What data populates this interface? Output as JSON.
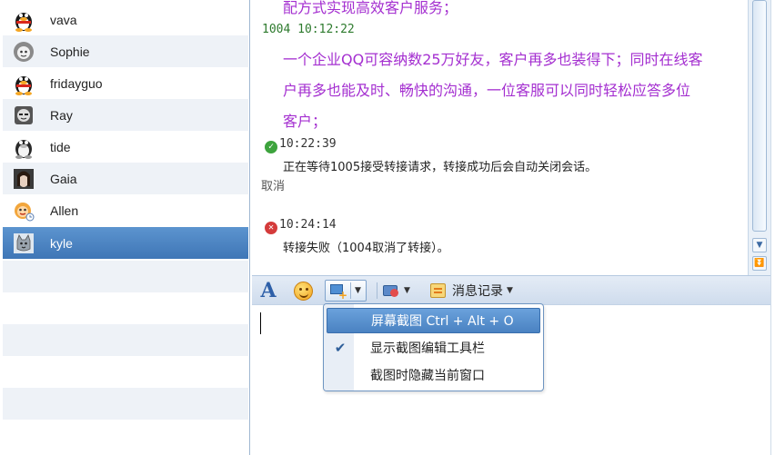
{
  "contacts": [
    {
      "name": "vava",
      "avatar": "penguin-icon"
    },
    {
      "name": "Sophie",
      "avatar": "avatar-girl-icon"
    },
    {
      "name": "fridayguo",
      "avatar": "penguin-icon"
    },
    {
      "name": "Ray",
      "avatar": "avatar-face-icon"
    },
    {
      "name": "tide",
      "avatar": "penguin-icon"
    },
    {
      "name": "Gaia",
      "avatar": "avatar-photo-icon"
    },
    {
      "name": "Allen",
      "avatar": "avatar-cartoon-icon"
    },
    {
      "name": "kyle",
      "avatar": "avatar-cat-icon",
      "selected": true
    }
  ],
  "chat": {
    "line_top": "配方式实现高效客户服务；",
    "msg1_meta": "1004  10:12:22",
    "msg1_line1": "一个企业QQ可容纳数25万好友，客户再多也装得下；同时在线客",
    "msg1_line2": "户再多也能及时、畅快的沟通，一位客服可以同时轻松应答多位",
    "msg1_line3": "客户；",
    "sys1_time": "10:22:39",
    "sys1_text": "正在等待1005接受转接请求，转接成功后会自动关闭会话。",
    "cancel": "取消",
    "sys2_time": "10:24:14",
    "sys2_text": "转接失败（1004取消了转接）。"
  },
  "toolbar": {
    "font_label": "A",
    "history_label": "消息记录"
  },
  "menu": {
    "items": [
      {
        "label": "屏幕截图 Ctrl + Alt + O",
        "checked": false,
        "highlighted": true
      },
      {
        "label": "显示截图编辑工具栏",
        "checked": true
      },
      {
        "label": "截图时隐藏当前窗口",
        "checked": false
      }
    ],
    "check_glyph": "✔"
  },
  "colors": {
    "selected_row": "#4a82c2",
    "message_text": "#a42fd0",
    "meta_text": "#2d7a2d"
  }
}
